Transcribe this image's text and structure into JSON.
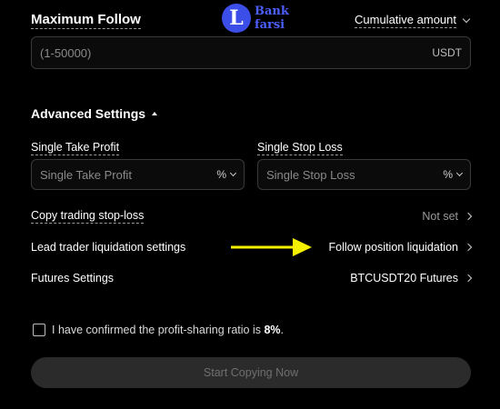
{
  "max_follow": {
    "label": "Maximum Follow",
    "mode_dropdown": "Cumulative amount",
    "input_placeholder": "(1-50000)",
    "input_unit": "USDT"
  },
  "watermark": {
    "logo_letter": "L",
    "line1": "Bank",
    "line2": "farsi"
  },
  "advanced": {
    "heading": "Advanced Settings",
    "take_profit": {
      "label": "Single Take Profit",
      "placeholder": "Single Take Profit",
      "unit": "%"
    },
    "stop_loss": {
      "label": "Single Stop Loss",
      "placeholder": "Single Stop Loss",
      "unit": "%"
    }
  },
  "settings_rows": [
    {
      "label": "Copy trading stop-loss",
      "value": "Not set"
    },
    {
      "label": "Lead trader liquidation settings",
      "value": "Follow position liquidation"
    },
    {
      "label": "Futures Settings",
      "value": "BTCUSDT20 Futures"
    }
  ],
  "confirm": {
    "text": "I have confirmed the profit-sharing ratio is",
    "ratio": "8%",
    "suffix": "."
  },
  "submit_button": "Start Copying Now",
  "colors": {
    "background": "#000000",
    "annotation_arrow": "#f5ef00",
    "logo_blue": "#3b4ee8",
    "button_disabled": "#2b2b2b"
  }
}
